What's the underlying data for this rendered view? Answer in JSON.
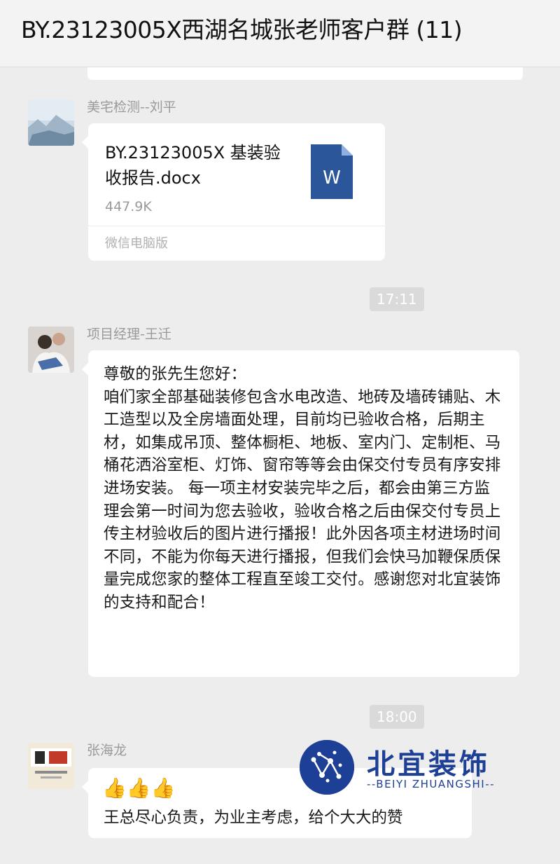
{
  "header": {
    "title": "BY.23123005X西湖名城张老师客户群 (11)"
  },
  "messages": [
    {
      "sender": "美宅检测--刘平",
      "type": "file",
      "file": {
        "name": "BY.23123005X 基装验收报告.docx",
        "size": "447.9K",
        "source": "微信电脑版",
        "icon": "word-doc-icon",
        "icon_letter": "W"
      }
    },
    {
      "type": "time",
      "text": "17:11"
    },
    {
      "sender": "项目经理-王迁",
      "type": "text",
      "text": "尊敬的张先生您好：\n咱们家全部基础装修包含水电改造、地砖及墙砖铺贴、木工造型以及全房墙面处理，目前均已验收合格，后期主材，如集成吊顶、整体橱柜、地板、室内门、定制柜、马桶花洒浴室柜、灯饰、窗帘等等会由保交付专员有序安排进场安装。 每一项主材安装完毕之后，都会由第三方监理会第一时间为您去验收，验收合格之后由保交付专员上传主材验收后的图片进行播报！此外因各项主材进场时间不同，不能为你每天进行播报，但我们会快马加鞭保质保量完成您家的整体工程直至竣工交付。感谢您对北宜装饰的支持和配合！"
    },
    {
      "type": "time",
      "text": "18:00"
    },
    {
      "sender": "张海龙",
      "type": "text",
      "emoji": "👍👍👍",
      "text": "王总尽心负责，为业主考虑，给个大大的赞"
    }
  ],
  "watermark": {
    "name": "北宜装饰",
    "subtitle": "--BEIYI ZHUANGSHI--"
  },
  "colors": {
    "background": "#ededed",
    "bubble": "#ffffff",
    "word_blue": "#2b579a",
    "brand_blue": "#1d3f95"
  }
}
